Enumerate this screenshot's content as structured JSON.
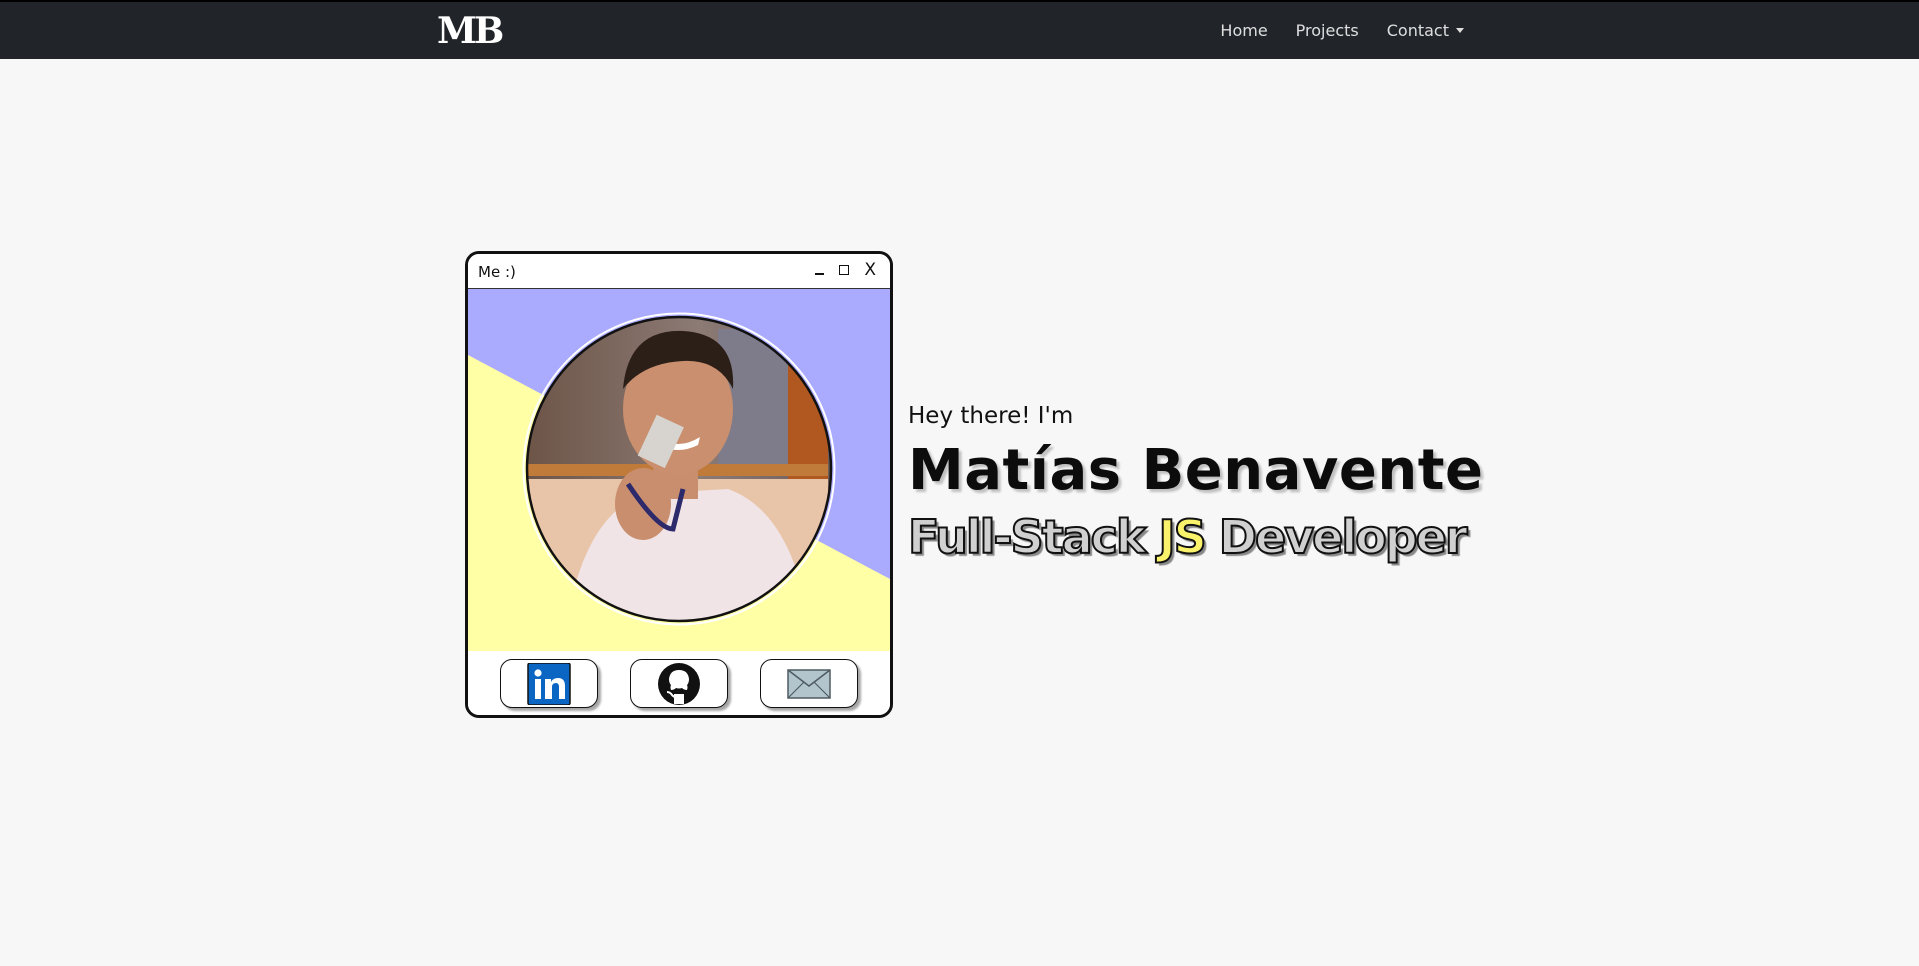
{
  "navbar": {
    "brand": "MB",
    "links": [
      {
        "label": "Home"
      },
      {
        "label": "Projects"
      },
      {
        "label": "Contact"
      }
    ]
  },
  "window": {
    "title": "Me :)",
    "controls": {
      "minimize": "–",
      "maximize": "□",
      "close": "X"
    },
    "photo_icon": "profile-photo",
    "background_colors": {
      "top": "#aaaaff",
      "bottom": "#ffffa6"
    },
    "social": [
      {
        "name": "linkedin",
        "icon": "linkedin-icon",
        "color": "#0a66c2"
      },
      {
        "name": "github",
        "icon": "github-icon",
        "color": "#111111"
      },
      {
        "name": "email",
        "icon": "envelope-icon",
        "color": "#b3c5cc"
      }
    ]
  },
  "hero": {
    "greeting": "Hey there! I'm",
    "name": "Matías Benavente",
    "role_prefix": "Full-Stack ",
    "role_highlight": "JS",
    "role_suffix": " Developer",
    "highlight_color": "#fbf26b"
  }
}
